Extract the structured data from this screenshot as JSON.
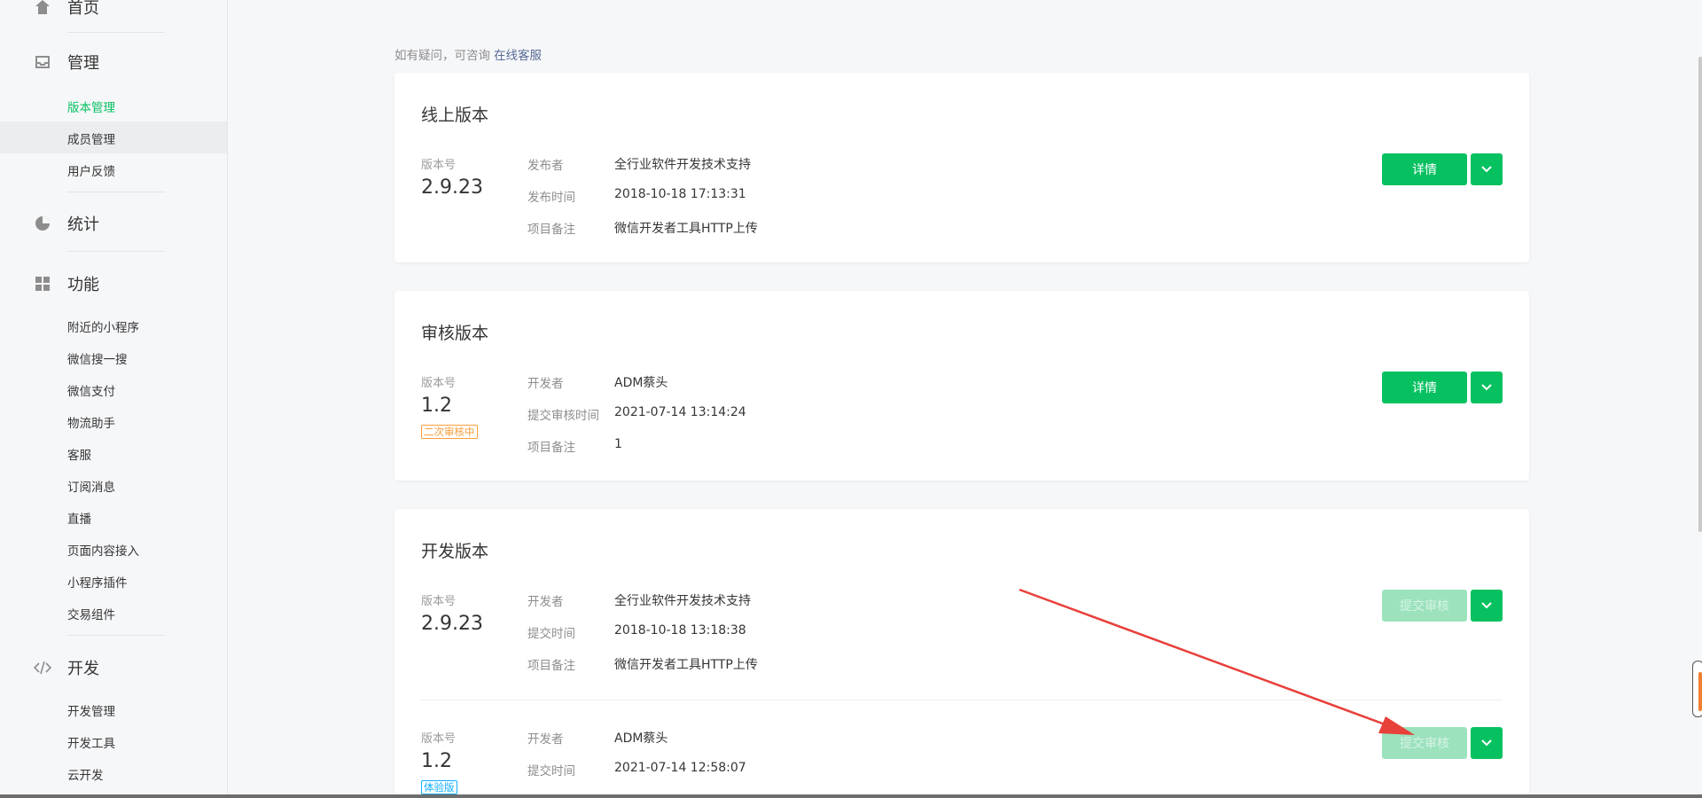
{
  "sidebar": {
    "home": "首页",
    "manage": "管理",
    "manage_items": [
      "版本管理",
      "成员管理",
      "用户反馈"
    ],
    "stats": "统计",
    "features": "功能",
    "feature_items": [
      "附近的小程序",
      "微信搜一搜",
      "微信支付",
      "物流助手",
      "客服",
      "订阅消息",
      "直播",
      "页面内容接入",
      "小程序插件",
      "交易组件"
    ],
    "dev": "开发",
    "dev_items": [
      "开发管理",
      "开发工具",
      "云开发"
    ]
  },
  "help": {
    "text": "如有疑问，可咨询",
    "link": "在线客服"
  },
  "online": {
    "title": "线上版本",
    "version_label": "版本号",
    "version": "2.9.23",
    "rows": [
      {
        "k": "发布者",
        "v": "全行业软件开发技术支持"
      },
      {
        "k": "发布时间",
        "v": "2018-10-18 17:13:31"
      },
      {
        "k": "项目备注",
        "v": "微信开发者工具HTTP上传"
      }
    ],
    "button": "详情"
  },
  "review": {
    "title": "审核版本",
    "version_label": "版本号",
    "version": "1.2",
    "tag": "二次审核中",
    "rows": [
      {
        "k": "开发者",
        "v": "ADM蔡头"
      },
      {
        "k": "提交审核时间",
        "v": "2021-07-14 13:14:24"
      },
      {
        "k": "项目备注",
        "v": "1"
      }
    ],
    "button": "详情"
  },
  "dev_card": {
    "title": "开发版本",
    "v1": {
      "version_label": "版本号",
      "version": "2.9.23",
      "rows": [
        {
          "k": "开发者",
          "v": "全行业软件开发技术支持"
        },
        {
          "k": "提交时间",
          "v": "2018-10-18 13:18:38"
        },
        {
          "k": "项目备注",
          "v": "微信开发者工具HTTP上传"
        }
      ],
      "button": "提交审核"
    },
    "v2": {
      "version_label": "版本号",
      "version": "1.2",
      "tag": "体验版",
      "rows": [
        {
          "k": "开发者",
          "v": "ADM蔡头"
        },
        {
          "k": "提交时间",
          "v": "2021-07-14 12:58:07"
        }
      ],
      "button": "提交审核"
    }
  },
  "colors": {
    "brand_green": "#07c160",
    "link": "#576b95",
    "warning": "#fa9d3b",
    "info": "#10aeff",
    "annotation_arrow": "#e8403a"
  }
}
